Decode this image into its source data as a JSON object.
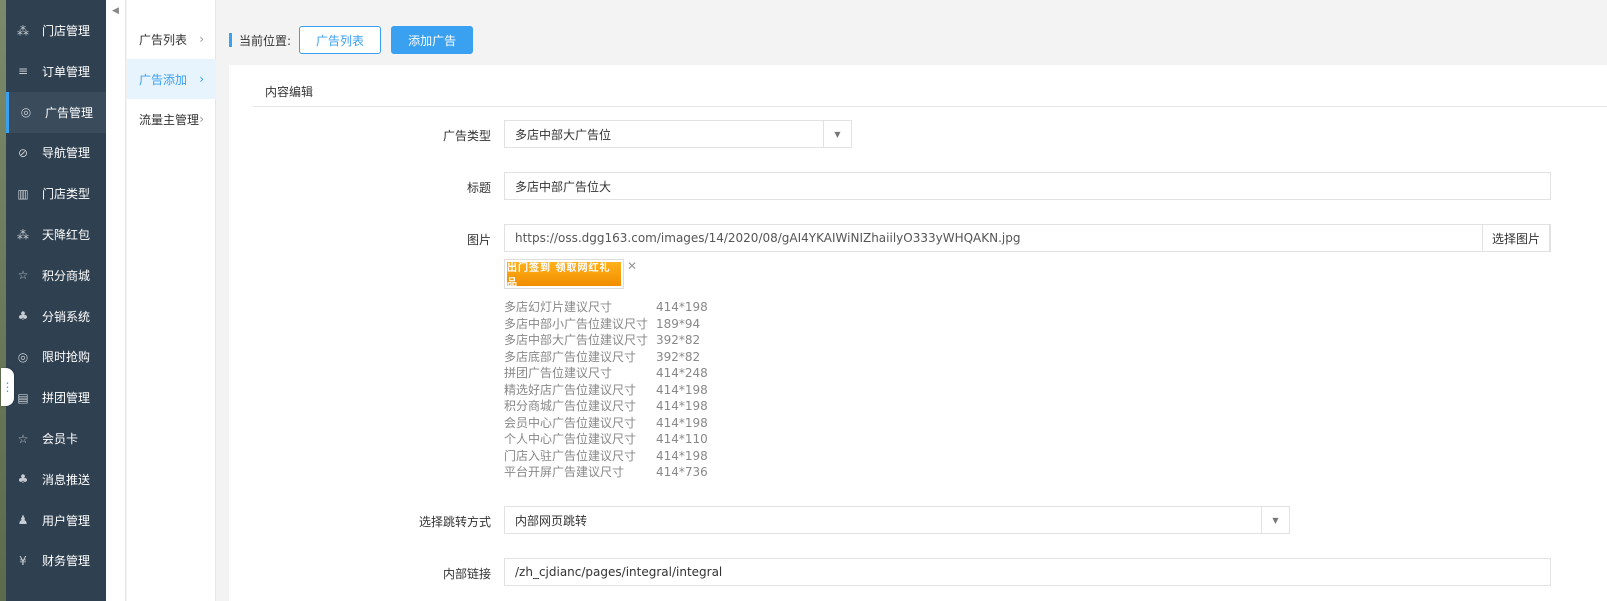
{
  "sidebar": {
    "items": [
      {
        "label": "门店管理",
        "icon": "cubes-icon",
        "glyph": "⁂",
        "active": false
      },
      {
        "label": "订单管理",
        "icon": "list-icon",
        "glyph": "≡",
        "active": false
      },
      {
        "label": "广告管理",
        "icon": "support-icon",
        "glyph": "◎",
        "active": true
      },
      {
        "label": "导航管理",
        "icon": "compass-icon",
        "glyph": "⊘",
        "active": false
      },
      {
        "label": "门店类型",
        "icon": "bank-icon",
        "glyph": "▥",
        "active": false
      },
      {
        "label": "天降红包",
        "icon": "cubes-icon",
        "glyph": "⁂",
        "active": false
      },
      {
        "label": "积分商城",
        "icon": "star-icon",
        "glyph": "☆",
        "active": false
      },
      {
        "label": "分销系统",
        "icon": "users-icon",
        "glyph": "♣",
        "active": false
      },
      {
        "label": "限时抢购",
        "icon": "support-icon",
        "glyph": "◎",
        "active": false
      },
      {
        "label": "拼团管理",
        "icon": "newspaper-icon",
        "glyph": "▤",
        "active": false
      },
      {
        "label": "会员卡",
        "icon": "star-icon",
        "glyph": "☆",
        "active": false
      },
      {
        "label": "消息推送",
        "icon": "users-icon",
        "glyph": "♣",
        "active": false
      },
      {
        "label": "用户管理",
        "icon": "user-icon",
        "glyph": "♟",
        "active": false
      },
      {
        "label": "财务管理",
        "icon": "yen-icon",
        "glyph": "¥",
        "active": false
      }
    ]
  },
  "subnav": {
    "items": [
      {
        "label": "广告列表",
        "active": false
      },
      {
        "label": "广告添加",
        "active": true
      },
      {
        "label": "流量主管理",
        "active": false
      }
    ]
  },
  "breadcrumb": {
    "label": "当前位置:",
    "list_button": "广告列表",
    "add_button": "添加广告"
  },
  "panel": {
    "title": "内容编辑"
  },
  "form": {
    "ad_type": {
      "label": "广告类型",
      "value": "多店中部大广告位"
    },
    "title": {
      "label": "标题",
      "value": "多店中部广告位大"
    },
    "image": {
      "label": "图片",
      "value": "https://oss.dgg163.com/images/14/2020/08/gAI4YKAIWiNIZhaiilyO333yWHQAKN.jpg",
      "pick_button": "选择图片",
      "thumb_text": "出门签到 领取网红礼品"
    },
    "size_hints": [
      {
        "name": "多店幻灯片建议尺寸",
        "size": "414*198"
      },
      {
        "name": "多店中部小广告位建议尺寸",
        "size": "189*94"
      },
      {
        "name": "多店中部大广告位建议尺寸",
        "size": "392*82"
      },
      {
        "name": "多店底部广告位建议尺寸",
        "size": "392*82"
      },
      {
        "name": "拼团广告位建议尺寸",
        "size": "414*248"
      },
      {
        "name": "精选好店广告位建议尺寸",
        "size": "414*198"
      },
      {
        "name": "积分商城广告位建议尺寸",
        "size": "414*198"
      },
      {
        "name": "会员中心广告位建议尺寸",
        "size": "414*198"
      },
      {
        "name": "个人中心广告位建议尺寸",
        "size": "414*110"
      },
      {
        "name": "门店入驻广告位建议尺寸",
        "size": "414*198"
      },
      {
        "name": "平台开屏广告建议尺寸",
        "size": "414*736"
      }
    ],
    "jump_type": {
      "label": "选择跳转方式",
      "value": "内部网页跳转"
    },
    "inner_link": {
      "label": "内部链接",
      "value": "/zh_cjdianc/pages/integral/integral"
    }
  },
  "colors": {
    "sidebar_bg": "#2f4050",
    "accent": "#3aa0f0"
  }
}
